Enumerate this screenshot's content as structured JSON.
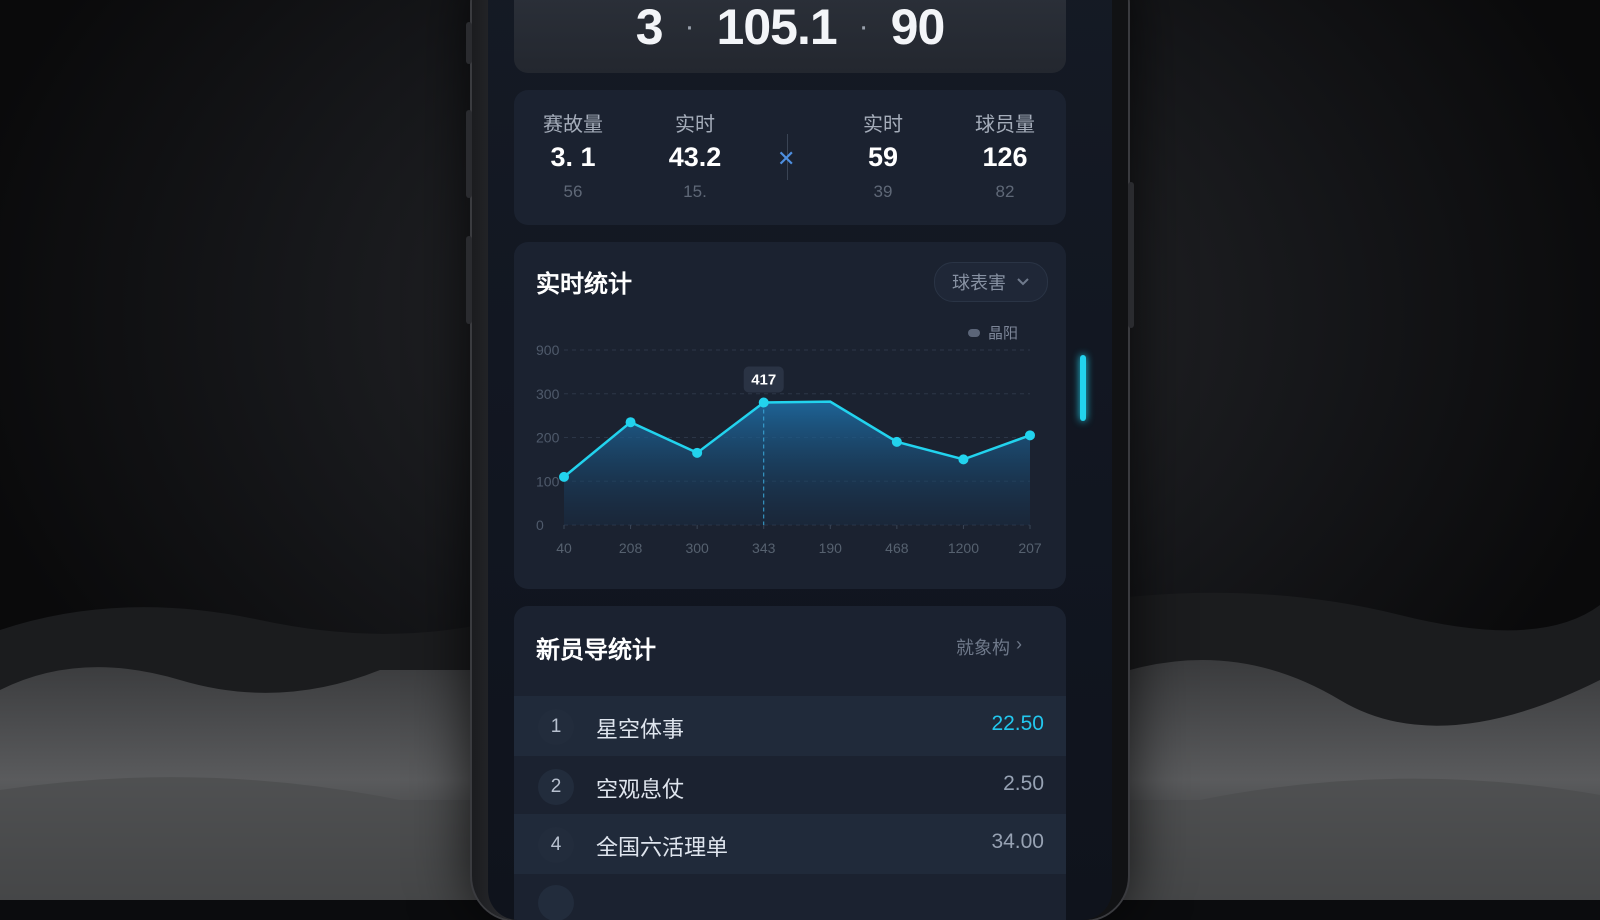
{
  "scoreboard": {
    "home": "3",
    "mid": "105.1",
    "away": "90"
  },
  "stats": [
    {
      "label": "赛故量",
      "value": "3. 1",
      "sub": "56"
    },
    {
      "label": "实时",
      "value": "43.2",
      "sub": "15."
    },
    {
      "label": "实时",
      "value": "59",
      "sub": "39"
    },
    {
      "label": "球员量",
      "value": "126",
      "sub": "82"
    }
  ],
  "realtime": {
    "title": "实时统计",
    "dropdown": "球表害",
    "legend": "晶阳",
    "tooltip": "417"
  },
  "chart_data": {
    "type": "area",
    "categories": [
      "40",
      "208",
      "300",
      "343",
      "190",
      "468",
      "1200",
      "207"
    ],
    "values": [
      110,
      235,
      165,
      280,
      190,
      150,
      205
    ],
    "points": [
      {
        "x": "40",
        "y": 110
      },
      {
        "x": "208",
        "y": 235
      },
      {
        "x": "300",
        "y": 165
      },
      {
        "x": "343",
        "y": 280
      },
      {
        "x": "190",
        "y": 282
      },
      {
        "x": "468",
        "y": 190
      },
      {
        "x": "1200",
        "y": 150
      },
      {
        "x": "207",
        "y": 205
      }
    ],
    "yticks": [
      "0",
      "100",
      "200",
      "300",
      "900"
    ],
    "ylim": [
      0,
      400
    ],
    "grid": true,
    "highlight_value": "417",
    "color": "#22d3ee"
  },
  "ranking": {
    "title": "新员导统计",
    "more": "就象构",
    "rows": [
      {
        "rank": "1",
        "name": "星空体事",
        "value": "22.50",
        "highlight": true
      },
      {
        "rank": "2",
        "name": "空观息仗",
        "value": "2.50",
        "highlight": false
      },
      {
        "rank": "4",
        "name": "全国六活理单",
        "value": "34.00",
        "highlight": false
      },
      {
        "rank": "",
        "name": "",
        "value": "",
        "highlight": false
      }
    ]
  },
  "colors": {
    "accent": "#22d3ee",
    "card": "#1b2230",
    "screen": "#131925"
  },
  "icons": [
    "cross-icon",
    "chevron-down-icon",
    "chevron-right-icon",
    "legend-dot-icon"
  ]
}
